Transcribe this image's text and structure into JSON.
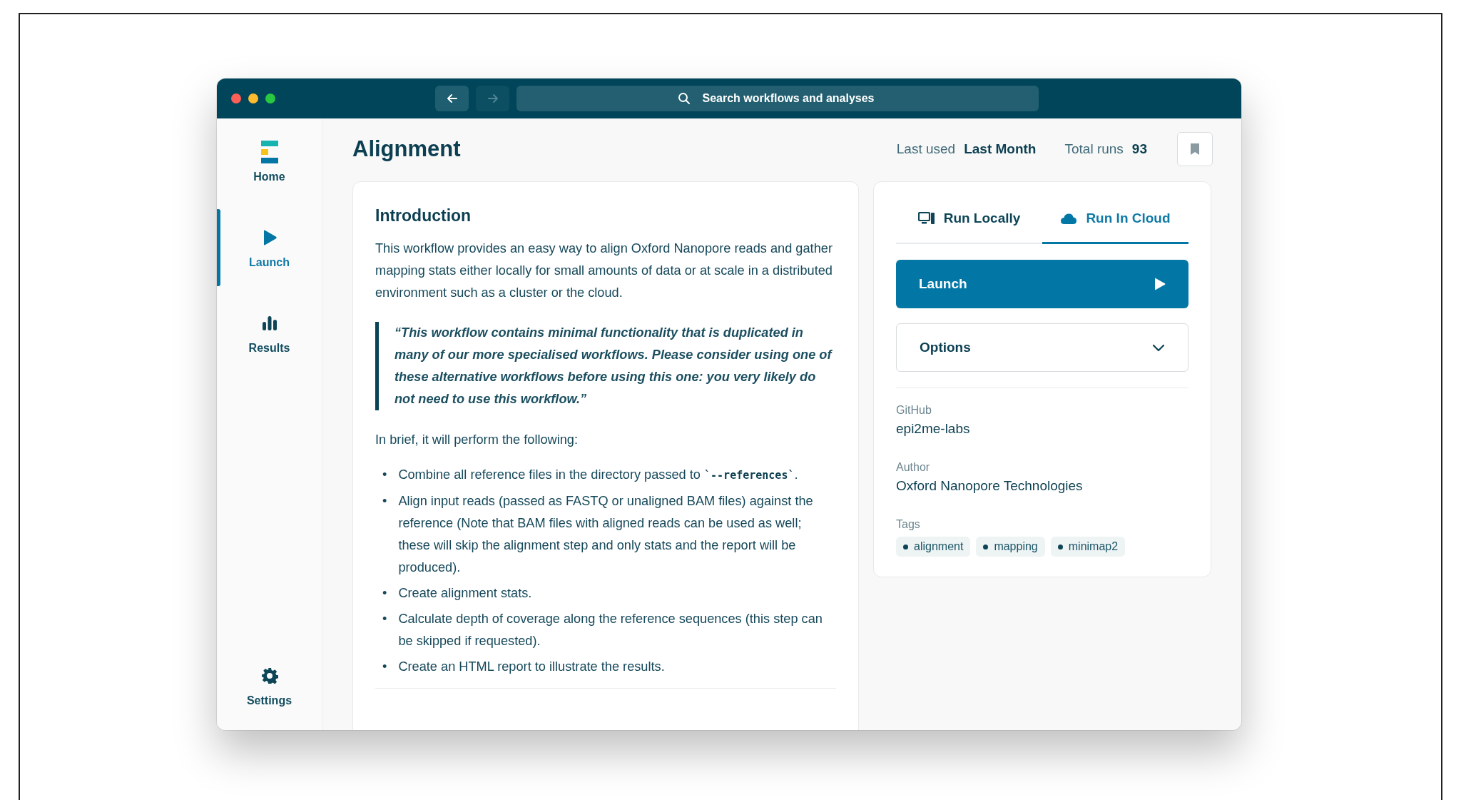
{
  "toolbar": {
    "nav": [
      {
        "kind": "back",
        "disabled": false
      },
      {
        "kind": "forward",
        "disabled": true
      }
    ],
    "search": {
      "placeholder": "Search workflows and analyses"
    }
  },
  "sidebar": {
    "items": [
      {
        "kind": "home",
        "label": "Home",
        "selected": false
      },
      {
        "kind": "launch",
        "label": "Launch",
        "selected": true
      },
      {
        "kind": "results",
        "label": "Results",
        "selected": false
      }
    ],
    "footer_items": [
      {
        "kind": "settings",
        "label": "Settings",
        "selected": false
      }
    ]
  },
  "header": {
    "title": "Alignment",
    "last_used_label": "Last used",
    "last_used": "Last Month",
    "total_runs_label": "Total runs",
    "total_runs": "93"
  },
  "introduction": {
    "heading": "Introduction",
    "paragraph": "This workflow provides an easy way to align Oxford Nanopore reads and gather mapping stats either locally for small amounts of data or at scale in a distributed environment such as a cluster or the cloud.",
    "quote": "“This workflow contains minimal functionality that is duplicated in many of our more specialised workflows. Please consider using one of these alternative workflows before using this one: you very likely do not need to use this workflow.”",
    "lead": "In brief, it will perform the following:",
    "steps": [
      {
        "marker": "•",
        "parts": [
          {
            "kind": "text",
            "text": "Combine all reference files in the directory passed to "
          },
          {
            "kind": "code",
            "text": "`--references`"
          },
          {
            "kind": "text",
            "text": "."
          }
        ]
      },
      {
        "marker": "•",
        "parts": [
          {
            "kind": "text",
            "text": "Align input reads (passed as FASTQ or unaligned BAM files) against the reference (Note that BAM files with aligned reads can be used as well; these will skip the alignment step and only stats and the report will be produced)."
          }
        ]
      },
      {
        "marker": "•",
        "parts": [
          {
            "kind": "text",
            "text": "Create alignment stats."
          }
        ]
      },
      {
        "marker": "•",
        "parts": [
          {
            "kind": "text",
            "text": "Calculate depth of coverage along the reference sequences (this step can be skipped if requested)."
          }
        ]
      },
      {
        "marker": "•",
        "parts": [
          {
            "kind": "text",
            "text": "Create an HTML report to illustrate the results."
          }
        ]
      }
    ]
  },
  "run_panel": {
    "tabs": [
      {
        "kind": "local",
        "label": "Run Locally",
        "selected": false
      },
      {
        "kind": "cloud",
        "label": "Run In Cloud",
        "selected": true
      }
    ],
    "launch_button": "Launch",
    "options": {
      "label": "Options",
      "expanded": false
    },
    "details": [
      {
        "label": "GitHub",
        "value": "epi2me-labs"
      },
      {
        "label": "Author",
        "value": "Oxford Nanopore Technologies"
      }
    ],
    "tags_label": "Tags",
    "tags": [
      "alignment",
      "mapping",
      "minimap2"
    ]
  }
}
